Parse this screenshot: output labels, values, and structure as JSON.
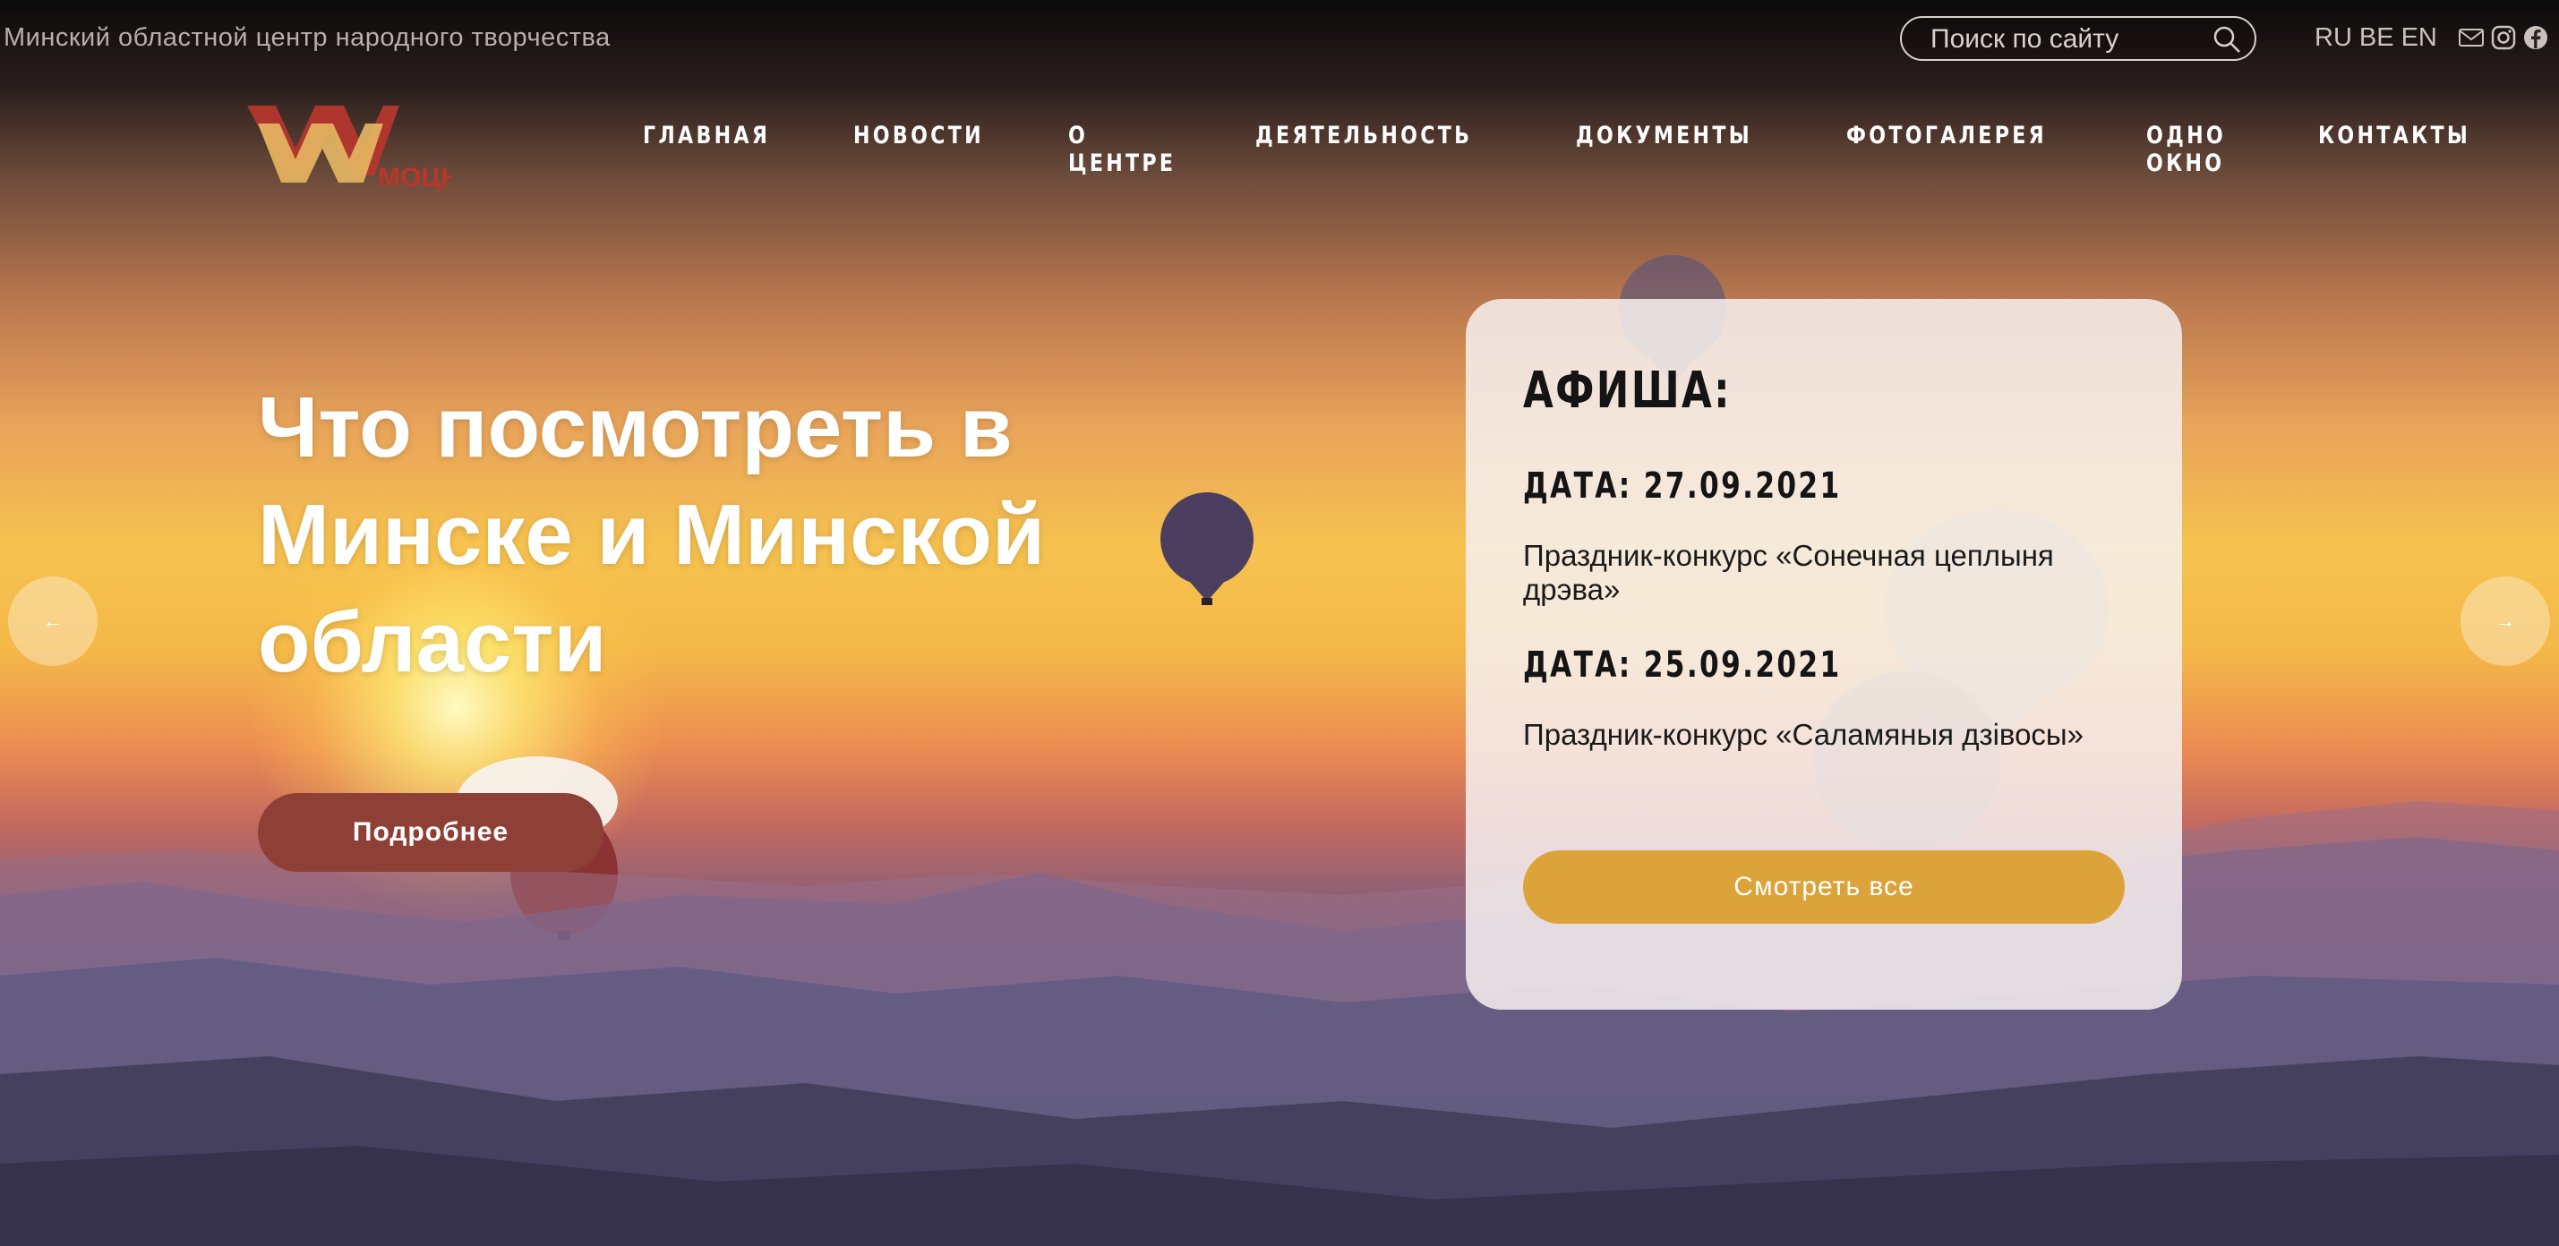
{
  "topbar": {
    "site_title": "Минский областной центр народного творчества",
    "search_placeholder": "Поиск по сайту",
    "languages": [
      "RU",
      "BE",
      "EN"
    ],
    "social_icons": [
      "mail-icon",
      "instagram-icon",
      "facebook-icon"
    ]
  },
  "logo": {
    "text": "МОЦНТ"
  },
  "nav": {
    "items": [
      "ГЛАВНАЯ",
      "НОВОСТИ",
      "О ЦЕНТРЕ",
      "ДЕЯТЕЛЬНОСТЬ",
      "ДОКУМЕНТЫ",
      "ФОТОГАЛЕРЕЯ",
      "ОДНО ОКНО",
      "КОНТАКТЫ"
    ]
  },
  "hero": {
    "title": "Что посмотреть в Минске и Минской области",
    "button_label": "Подробнее",
    "prev_arrow": "←",
    "next_arrow": "→"
  },
  "afisha": {
    "title": "АФИША:",
    "events": [
      {
        "date": "ДАТА: 27.09.2021",
        "name": "Праздник-конкурс «Сонечная цеплыня дрэва»"
      },
      {
        "date": "ДАТА: 25.09.2021",
        "name": "Праздник-конкурс «Саламяныя дзівосы»"
      }
    ],
    "button_label": "Смотреть все"
  },
  "colors": {
    "accent_red": "#8e4037",
    "accent_gold": "#dca33a"
  }
}
